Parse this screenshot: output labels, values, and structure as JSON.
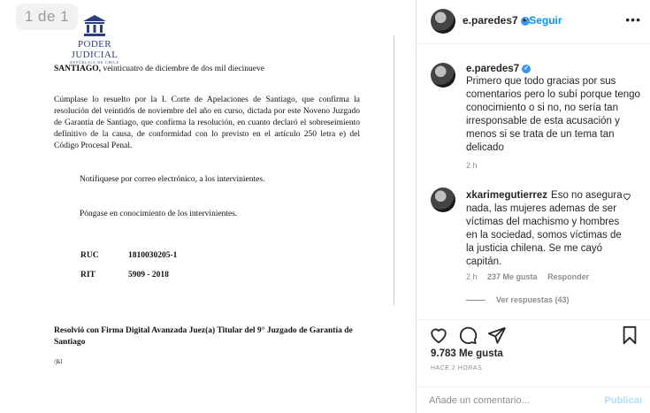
{
  "viewer": {
    "page_counter": "1 de 1",
    "logo": {
      "title": "PODER JUDICIAL",
      "subtitle": "REPÚBLICA DE CHILE"
    },
    "document": {
      "date_place": "SANTIAGO,",
      "date_text": "veinticuatro de diciembre de dos mil diecinueve",
      "paragraph": "Cúmplase lo resuelto por la I. Corte de Apelaciones de Santiago, que confirma la resolución del veintidós de noviembre del año en curso, dictada por este Noveno Juzgado de Garantía de Santiago, que confirma la resolución, en cuanto declaró el sobreseimiento definitivo de la causa, de conformidad con lo previsto en el artículo 250 letra e) del Código Procesal Penal.",
      "notify": "Notifíquese por correo electrónico, a los intervinientes.",
      "knowledge": "Póngase en conocimiento de los intervinientes.",
      "ruc_label": "RUC",
      "ruc_value": "1810030205-1",
      "rit_label": "RIT",
      "rit_value": "5909 - 2018",
      "signature": "Resolvió con Firma Digital Avanzada Juez(a) Titular del 9° Juzgado de Garantía de Santiago",
      "initials": "/jkl"
    }
  },
  "post": {
    "username": "e.paredes7",
    "follow_label": "Seguir",
    "more_icon": "more-horizontal-icon",
    "caption": {
      "username": "e.paredes7",
      "text": "Primero que todo gracias por sus comentarios pero lo subí porque tengo conocimiento o si no, no sería tan irresponsable de esta acusación y menos si se trata de un tema tan delicado",
      "time": "2 h"
    },
    "comments": [
      {
        "username": "xkarimegutierrez",
        "text": "Eso no asegura nada, las mujeres ademas de ser víctimas del machismo y hombres en la sociedad, somos víctimas de la justicia chilena. Se me cayó capitán.",
        "time": "2 h",
        "likes": "237 Me gusta",
        "reply_label": "Responder",
        "view_replies": "Ver respuestas (43)"
      }
    ],
    "likes": "9.783 Me gusta",
    "ago": "HACE 2 HORAS",
    "comment_placeholder": "Añade un comentario...",
    "publish_label": "Publicar"
  },
  "colors": {
    "accent": "#0095f6",
    "verified": "#3897f0",
    "muted": "#8e8e8e",
    "publish_disabled": "#b2dffc",
    "logo": "#2b3f7a"
  }
}
